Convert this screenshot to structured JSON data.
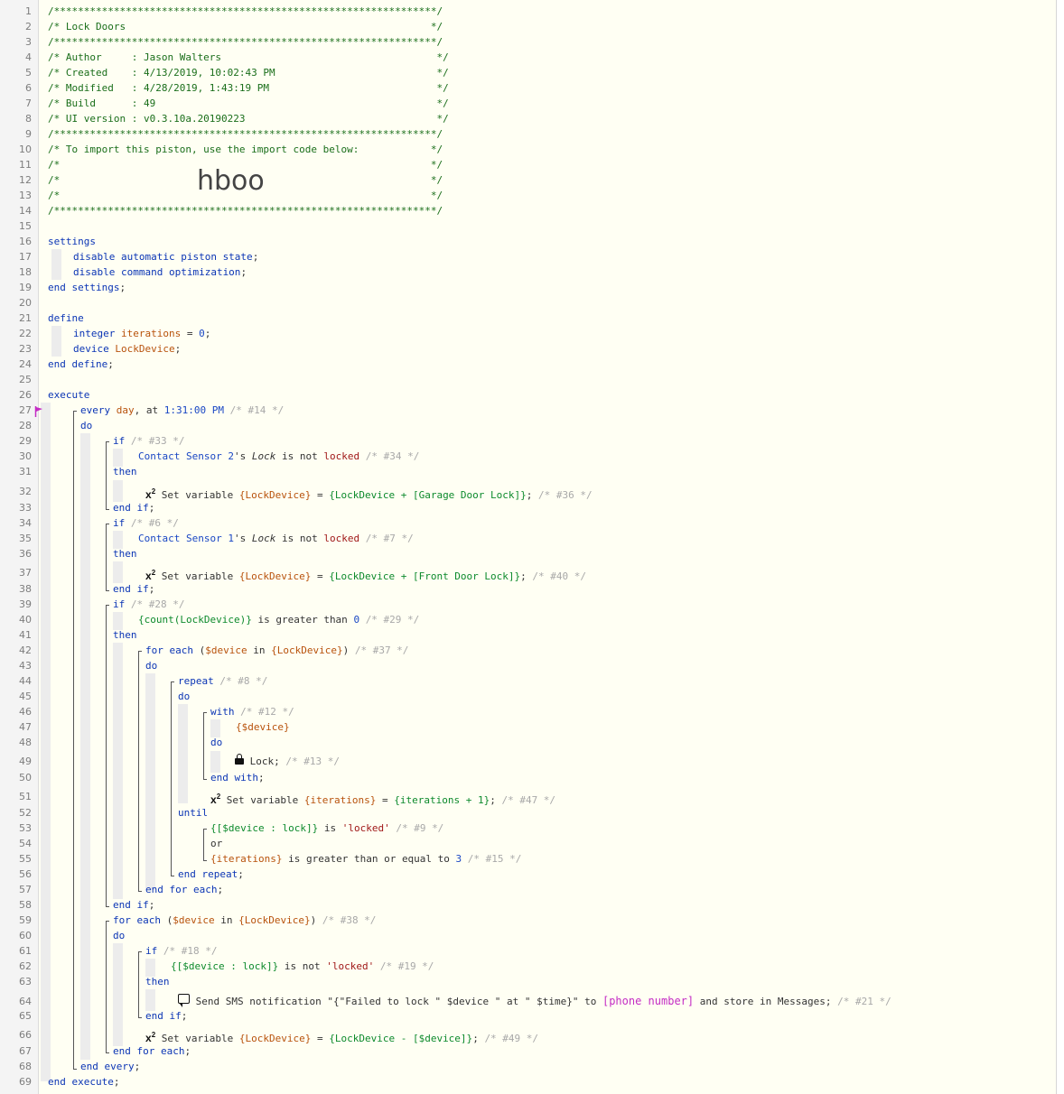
{
  "header": {
    "l1": "/****************************************************************/",
    "l2": "/* Lock Doors                                                   */",
    "l3": "/****************************************************************/",
    "l4": "/* Author     : Jason Walters                                    */",
    "l5": "/* Created    : 4/13/2019, 10:02:43 PM                           */",
    "l6": "/* Modified   : 4/28/2019, 1:43:19 PM                            */",
    "l7": "/* Build      : 49                                               */",
    "l8": "/* UI version : v0.3.10a.20190223                                */",
    "l9": "/****************************************************************/",
    "l10": "/* To import this piston, use the import code below:            */",
    "l11": "/*                                                              */",
    "l12": "/*                                                              */",
    "l13": "/*                                                              */",
    "l14": "/****************************************************************/",
    "import_code": "hboo"
  },
  "line_numbers": [
    "1",
    "2",
    "3",
    "4",
    "5",
    "6",
    "7",
    "8",
    "9",
    "10",
    "11",
    "12",
    "13",
    "14",
    "15",
    "16",
    "17",
    "18",
    "19",
    "20",
    "21",
    "22",
    "23",
    "24",
    "25",
    "26",
    "27",
    "28",
    "29",
    "30",
    "31",
    "32",
    "33",
    "34",
    "35",
    "36",
    "37",
    "38",
    "39",
    "40",
    "41",
    "42",
    "43",
    "44",
    "45",
    "46",
    "47",
    "48",
    "49",
    "50",
    "51",
    "52",
    "53",
    "54",
    "55",
    "56",
    "57",
    "58",
    "59",
    "60",
    "61",
    "62",
    "63",
    "64",
    "65",
    "66",
    "67",
    "68",
    "69"
  ],
  "code": {
    "settings": "settings",
    "disable_state": "disable automatic piston state",
    "disable_cmd": "disable command optimization",
    "end_settings": "end settings",
    "define": "define",
    "integer": "integer",
    "iterations": "iterations",
    "zero": "0",
    "device": "device",
    "lockdevice": "LockDevice",
    "end_define": "end define",
    "execute": "execute",
    "every": "every",
    "day": "day",
    "at": "at",
    "time": "1:31:00 PM",
    "c14": "/* #14 */",
    "do": "do",
    "if": "if",
    "then": "then",
    "end_if": "end if",
    "c33": "/* #33 */",
    "cs2": "Contact Sensor 2",
    "s_lock_label": "'s",
    "lock_attr": "Lock",
    "is_not": "is not",
    "locked": "locked",
    "c34": "/* #34 */",
    "set_var": "Set variable",
    "lockdevice_var": "{LockDevice}",
    "eq": "=",
    "expr_garage": "{LockDevice + [Garage Door Lock]}",
    "c36": "/* #36 */",
    "c6": "/* #6 */",
    "cs1": "Contact Sensor 1",
    "c7": "/* #7 */",
    "expr_front": "{LockDevice + [Front Door Lock]}",
    "c40": "/* #40 */",
    "c28": "/* #28 */",
    "count_expr": "{count(LockDevice)}",
    "greater_than": "is greater than",
    "c29": "/* #29 */",
    "for_each": "for each",
    "device_var": "$device",
    "in": "in",
    "lockdevice_brace": "{LockDevice}",
    "c37": "/* #37 */",
    "repeat": "repeat",
    "c8": "/* #8 */",
    "with": "with",
    "c12": "/* #12 */",
    "device_brace": "{$device}",
    "lock_cmd": "Lock",
    "c13": "/* #13 */",
    "end_with": "end with",
    "iterations_var": "{iterations}",
    "iter_expr": "{iterations + 1}",
    "c47": "/* #47 */",
    "until": "until",
    "device_lock_expr": "{[$device : lock]}",
    "is": "is",
    "locked_str": "'locked'",
    "c9": "/* #9 */",
    "or": "or",
    "gte": "is greater than or equal to",
    "three": "3",
    "c15": "/* #15 */",
    "end_repeat": "end repeat",
    "end_for_each": "end for each",
    "c38": "/* #38 */",
    "c18": "/* #18 */",
    "c19": "/* #19 */",
    "send_sms": "Send SMS notification",
    "sms_msg": "\"{\"Failed to lock \" $device \" at \" $time}\"",
    "to": "to",
    "phone": "[phone number]",
    "store": "and store in Messages",
    "c21": "/* #21 */",
    "expr_minus": "{LockDevice - [$device]}",
    "c49": "/* #49 */",
    "end_every": "end every",
    "end_execute": "end execute"
  },
  "colors": {
    "keyword": "#0b35b5",
    "comment": "#a8a8a8",
    "variable": "#b8520c",
    "expression": "#0d8a2c",
    "string": "#a01818",
    "phone": "#c42cc4",
    "editor_bg": "#fffff3"
  },
  "icons": [
    "x2-icon",
    "lock-icon",
    "message-bubble-icon",
    "flag-icon"
  ]
}
